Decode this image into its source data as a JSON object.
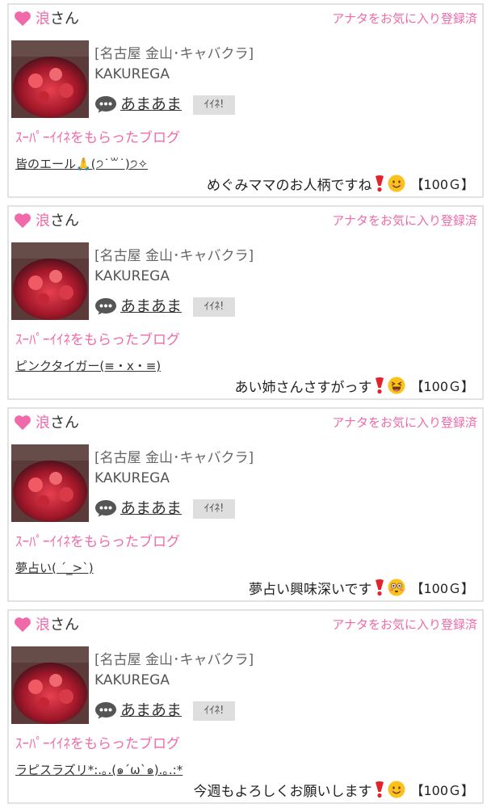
{
  "colors": {
    "accent": "#f06aa9",
    "border": "#e2e2e2",
    "badge_bg": "#dedede"
  },
  "posts": [
    {
      "user_name_accent": "浪",
      "user_name_suffix": "さん",
      "fav_status": "アナタをお気に入り登録済",
      "shop_area": "[名古屋 金山･キャバクラ]",
      "shop_name": "KAKUREGA",
      "cast_name": "あまあま",
      "like_label": "ｲｲﾈ!",
      "section_label": "ｽｰﾊﾟｰｲｲﾈをもらったブログ",
      "blog_title": "皆のエール🙏(੭˙꒳˙)੭✧",
      "comment": "めぐみママのお人柄ですね",
      "emoji": "smile-emoji",
      "points": "【100Ｇ】"
    },
    {
      "user_name_accent": "浪",
      "user_name_suffix": "さん",
      "fav_status": "アナタをお気に入り登録済",
      "shop_area": "[名古屋 金山･キャバクラ]",
      "shop_name": "KAKUREGA",
      "cast_name": "あまあま",
      "like_label": "ｲｲﾈ!",
      "section_label": "ｽｰﾊﾟｰｲｲﾈをもらったブログ",
      "blog_title": "ピンクタイガー(≡・x・≡)",
      "comment": "あい姉さんさすがっす",
      "emoji": "laughing-emoji",
      "points": "【100Ｇ】"
    },
    {
      "user_name_accent": "浪",
      "user_name_suffix": "さん",
      "fav_status": "アナタをお気に入り登録済",
      "shop_area": "[名古屋 金山･キャバクラ]",
      "shop_name": "KAKUREGA",
      "cast_name": "あまあま",
      "like_label": "ｲｲﾈ!",
      "section_label": "ｽｰﾊﾟｰｲｲﾈをもらったブログ",
      "blog_title": "夢占い(  ˊ_>ˋ)",
      "comment": "夢占い興味深いです",
      "emoji": "flushed-emoji",
      "points": "【100Ｇ】"
    },
    {
      "user_name_accent": "浪",
      "user_name_suffix": "さん",
      "fav_status": "アナタをお気に入り登録済",
      "shop_area": "[名古屋 金山･キャバクラ]",
      "shop_name": "KAKUREGA",
      "cast_name": "あまあま",
      "like_label": "ｲｲﾈ!",
      "section_label": "ｽｰﾊﾟｰｲｲﾈをもらったブログ",
      "blog_title": "ラピスラズリ*:.｡.(๑´ω`๑).｡.:*",
      "comment": "今週もよろしくお願いします",
      "emoji": "smile-emoji",
      "points": "【100Ｇ】"
    }
  ]
}
